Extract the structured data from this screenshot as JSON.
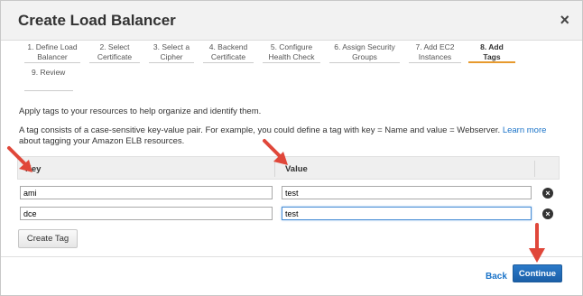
{
  "dialog": {
    "title": "Create Load Balancer",
    "close_symbol": "×"
  },
  "steps": [
    {
      "line1": "1. Define Load",
      "line2": "Balancer",
      "active": false
    },
    {
      "line1": "2. Select",
      "line2": "Certificate",
      "active": false
    },
    {
      "line1": "3. Select a",
      "line2": "Cipher",
      "active": false
    },
    {
      "line1": "4. Backend",
      "line2": "Certificate",
      "active": false
    },
    {
      "line1": "5. Configure",
      "line2": "Health Check",
      "active": false
    },
    {
      "line1": "6. Assign Security",
      "line2": "Groups",
      "active": false
    },
    {
      "line1": "7. Add EC2",
      "line2": "Instances",
      "active": false
    },
    {
      "line1": "8. Add",
      "line2": "Tags",
      "active": true
    },
    {
      "line1": "9. Review",
      "line2": "",
      "active": false
    }
  ],
  "intro": "Apply tags to your resources to help organize and identify them.",
  "description": {
    "text": "A tag consists of a case-sensitive key-value pair. For example, you could define a tag with key = Name and value = Webserver.",
    "link": "Learn more",
    "tail": "about tagging your Amazon ELB resources."
  },
  "table": {
    "headers": {
      "key": "Key",
      "value": "Value"
    },
    "rows": [
      {
        "key": "ami",
        "value": "test"
      },
      {
        "key": "dce",
        "value": "test"
      }
    ],
    "remove_symbol": "×"
  },
  "buttons": {
    "create_tag": "Create Tag",
    "back": "Back",
    "continue": "Continue"
  },
  "colors": {
    "accent_arrow": "#e0473a",
    "primary": "#1b5fa8",
    "active_step": "#e79a2d",
    "link": "#1a73c8"
  }
}
